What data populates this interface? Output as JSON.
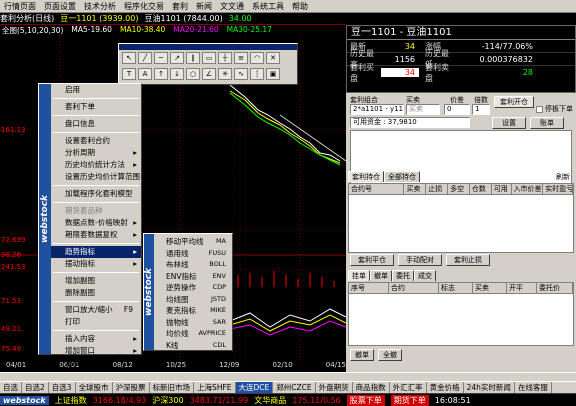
{
  "menubar": [
    "行情页面",
    "页面设置",
    "技术分析",
    "程序化交易",
    "套利",
    "新闻",
    "文文通",
    "系统工具",
    "帮助"
  ],
  "infobar": {
    "title": "套利分析(日线)",
    "series1": "豆一1101 (3939.00)",
    "series2": "豆油1101 (7844.00)",
    "value": "34.00",
    "ma_line": "全图(5,10,20,30)",
    "ma5": "MA5-19.60",
    "ma10": "MA10-38.40",
    "ma20": "MA20-21.60",
    "ma30": "MA30-25.17"
  },
  "chart_labels": {
    "y": [
      "161.13",
      "72.699",
      "96.26",
      "241.53",
      "71.53",
      "49.21",
      "75.49"
    ],
    "x": [
      "04/01",
      "06/01",
      "08/12",
      "10/25",
      "12/09",
      "02/10",
      "04/15"
    ]
  },
  "ctx1": [
    {
      "label": "启用",
      "dis": false
    },
    {
      "sep": true
    },
    {
      "label": "套利下单",
      "dis": false
    },
    {
      "sep": true
    },
    {
      "label": "盘口信息",
      "dis": false
    },
    {
      "sep": true
    },
    {
      "label": "设置套利合约",
      "dis": false
    },
    {
      "label": "分析周期",
      "dis": false,
      "arrow": true
    },
    {
      "label": "历史均价统计方法",
      "dis": false,
      "arrow": true
    },
    {
      "label": "设置历史均价计算范围",
      "dis": false
    },
    {
      "sep": true
    },
    {
      "label": "加载程序化套利模型",
      "dis": false
    },
    {
      "sep": true
    },
    {
      "label": "期货套品种",
      "dis": true
    },
    {
      "label": "数据点数-价格映射",
      "dis": false,
      "arrow": true
    },
    {
      "label": "期限套数据复权",
      "dis": false,
      "arrow": true
    },
    {
      "sep": true
    },
    {
      "label": "趋势指标",
      "dis": false,
      "arrow": true,
      "sel": true
    },
    {
      "label": "摆动指标",
      "dis": false,
      "arrow": true
    },
    {
      "sep": true
    },
    {
      "label": "增加副图",
      "dis": false
    },
    {
      "label": "删除副图",
      "dis": false
    },
    {
      "sep": true
    },
    {
      "label": "窗口放大/缩小",
      "dis": false,
      "key": "F9"
    },
    {
      "label": "打印",
      "dis": false
    },
    {
      "sep": true
    },
    {
      "label": "插入内容",
      "dis": false,
      "arrow": true
    },
    {
      "label": "增加窗口",
      "dis": false,
      "arrow": true
    },
    {
      "label": "删除窗口",
      "dis": false
    }
  ],
  "ctx2": [
    {
      "label": "移动平均线",
      "code": "MA"
    },
    {
      "label": "通用线",
      "code": "FUSU"
    },
    {
      "label": "布林线",
      "code": "BOLL"
    },
    {
      "label": "ENV指标",
      "code": "ENV"
    },
    {
      "label": "逆势操作",
      "code": "CDP"
    },
    {
      "label": "均线图",
      "code": "JSTD"
    },
    {
      "label": "麦克指标",
      "code": "MIKE"
    },
    {
      "label": "抛物线",
      "code": "SAR"
    },
    {
      "label": "均价线",
      "code": "AVPRICE"
    },
    {
      "label": "K线",
      "code": "CDL"
    }
  ],
  "watermark": "webstock",
  "quote": {
    "title": "豆一1101 - 豆油1101",
    "rows": [
      {
        "l1": "最新",
        "v1": "34",
        "l2": "涨幅",
        "v2": "-114/77.06%"
      },
      {
        "l1": "历史最高",
        "v1": "1156",
        "l2": "历史最低",
        "v2": "0.000376832"
      },
      {
        "l1": "套利买盘",
        "v1": "34",
        "l2": "套利卖盘",
        "v2": "28"
      }
    ]
  },
  "arb": {
    "h": [
      "套利组合",
      "买卖",
      "价差",
      "倍数"
    ],
    "combo": "2*a1101 - y1101",
    "side": "买卖",
    "price": "0",
    "mult": "1",
    "btn_open": "套利开仓",
    "chk": "停板下单",
    "fund": "可用资金 : 37,9810",
    "set": "设置",
    "acct": "账单"
  },
  "tabs1": [
    "套利持仓",
    "全部持仓"
  ],
  "refresh": "刷新",
  "grid1": [
    "合约号",
    "买卖",
    "止损",
    "多空",
    "仓数",
    "可用",
    "入市价差",
    "实时盈亏"
  ],
  "btns": [
    "套利平仓",
    "手动配对",
    "套利止损"
  ],
  "tabs2": [
    "挂单",
    "撤单",
    "委托",
    "成交"
  ],
  "grid2": [
    "序号",
    "合约",
    "标志",
    "买卖",
    "开平",
    "委托价"
  ],
  "btns2": [
    "撤单",
    "全撤"
  ],
  "taskbar": [
    "自选",
    "自选2",
    "自选3",
    "全球股市",
    "沪深股票",
    "标新旧市场",
    "上海SHFE",
    "大连DCE",
    "郑州CZCE",
    "外盘期货",
    "商品指数",
    "外汇汇率",
    "黄金价格",
    "24h实时新闻",
    "在线客服"
  ],
  "taskbar_active": "大连DCE",
  "status": {
    "s1": "上证指数",
    "v1": "3166.18/4.93",
    "s2": "沪深300",
    "v2": "3483.71/11.99",
    "s3": "文华商品",
    "v3": "175.11/0.56",
    "buy": "股票下单",
    "sell": "期货下单",
    "time": "16:08:51"
  }
}
